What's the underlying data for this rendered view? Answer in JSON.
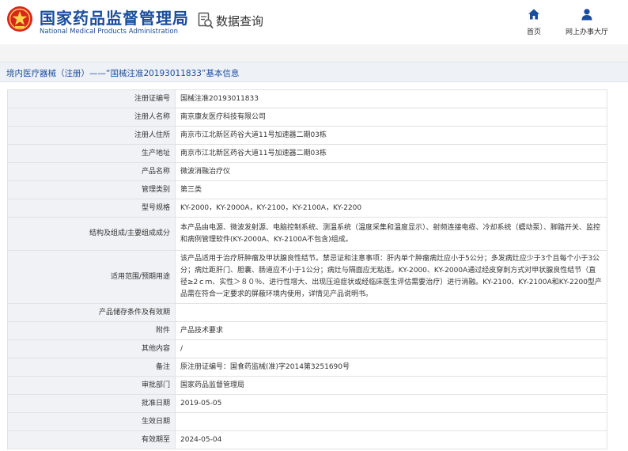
{
  "header": {
    "org_name_cn": "国家药品监督管理局",
    "org_name_en": "National Medical Products Administration",
    "section_title": "数据查询",
    "nav": [
      {
        "label": "首页",
        "icon": "home-icon"
      },
      {
        "label": "网上办事大厅",
        "icon": "user-icon"
      }
    ],
    "brand_color": "#1a4d9e",
    "logo_color": "#d7261e"
  },
  "record_title": "境内医疗器械（注册）——“国械注准20193011833”基本信息",
  "fields": [
    {
      "label": "注册证编号",
      "value": "国械注准20193011833"
    },
    {
      "label": "注册人名称",
      "value": "南京康友医疗科技有限公司"
    },
    {
      "label": "注册人住所",
      "value": "南京市江北新区药谷大道11号加速器二期03栋"
    },
    {
      "label": "生产地址",
      "value": "南京市江北新区药谷大道11号加速器二期03栋"
    },
    {
      "label": "产品名称",
      "value": "微波消融治疗仪"
    },
    {
      "label": "管理类别",
      "value": "第三类"
    },
    {
      "label": "型号规格",
      "value": "KY-2000，KY-2000A，KY-2100，KY-2100A，KY-2200"
    },
    {
      "label": "结构及组成/主要组成成分",
      "value": "本产品由电源、微波发射源、电脑控制系统、测温系统（温度采集和温度显示）、射频连接电缆、冷却系统（蠕动泵）、脚踏开关、监控和病例管理软件(KY-2000A、KY-2100A不包含)组成。"
    },
    {
      "label": "适用范围/预期用途",
      "value": "该产品适用于治疗肝肿瘤及甲状腺良性结节。禁忌证和注意事项：肝内单个肿瘤病灶应小于5公分；多发病灶应少于3个且每个小于3公分；病灶距肝门、胆囊、肠道应不小于1公分；病灶与隔面应无粘连。KY-2000、KY-2000A通过经皮穿刺方式对甲状腺良性结节（直径≥2ｃｍ、实性＞８０％、进行性增大、出现压迫症状或经临床医生评估需要治疗）进行消融。KY-2100、KY-2100A和KY-2200型产品需在符合一定要求的屏蔽环境内使用，详情见产品说明书。"
    },
    {
      "label": "产品储存条件及有效期",
      "value": ""
    },
    {
      "label": "附件",
      "value": "产品技术要求"
    },
    {
      "label": "其他内容",
      "value": "/"
    },
    {
      "label": "备注",
      "value": "原注册证编号：国食药监械(准)字2014第3251690号"
    },
    {
      "label": "审批部门",
      "value": "国家药品监督管理局"
    },
    {
      "label": "批准日期",
      "value": "2019-05-05"
    },
    {
      "label": "生效日期",
      "value": ""
    },
    {
      "label": "有效期至",
      "value": "2024-05-04"
    }
  ]
}
